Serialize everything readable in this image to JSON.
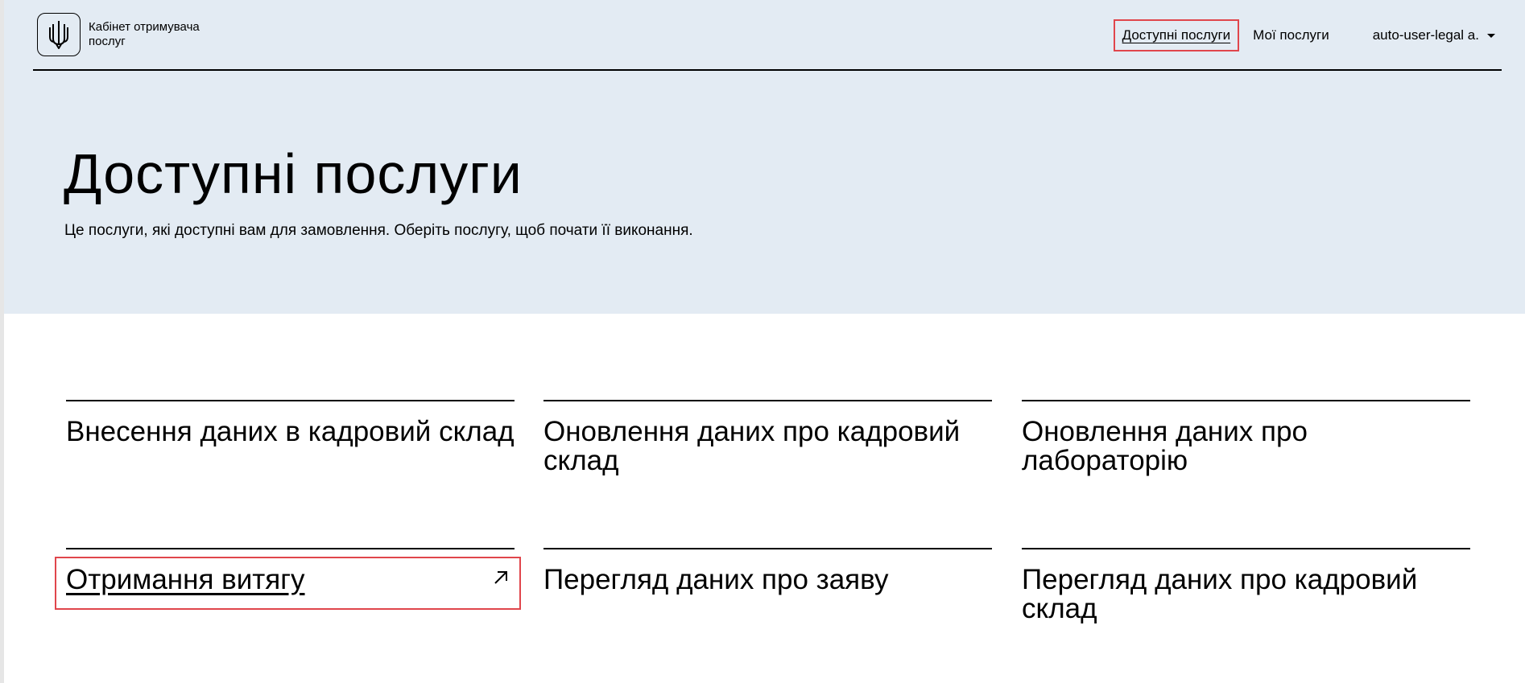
{
  "header": {
    "brand_line1": "Кабінет отримувача",
    "brand_line2": "послуг",
    "nav": {
      "available": "Доступні послуги",
      "mine": "Мої послуги",
      "user": "auto-user-legal a."
    }
  },
  "hero": {
    "title": "Доступні послуги",
    "subtitle": "Це послуги, які доступні вам для замовлення. Оберіть послугу, щоб почати її виконання."
  },
  "services": [
    {
      "label": "Внесення даних в кадровий склад"
    },
    {
      "label": "Оновлення даних про кадровий склад"
    },
    {
      "label": "Оновлення даних про лабораторію"
    },
    {
      "label": "Отримання витягу"
    },
    {
      "label": "Перегляд даних про заяву"
    },
    {
      "label": "Перегляд даних про кадровий склад"
    }
  ],
  "icons": {
    "logo": "trident-icon",
    "user_menu": "caret-down-icon",
    "external": "arrow-up-right-icon"
  },
  "colors": {
    "hero_bg": "#e3ebf3",
    "highlight": "#e0464c"
  }
}
